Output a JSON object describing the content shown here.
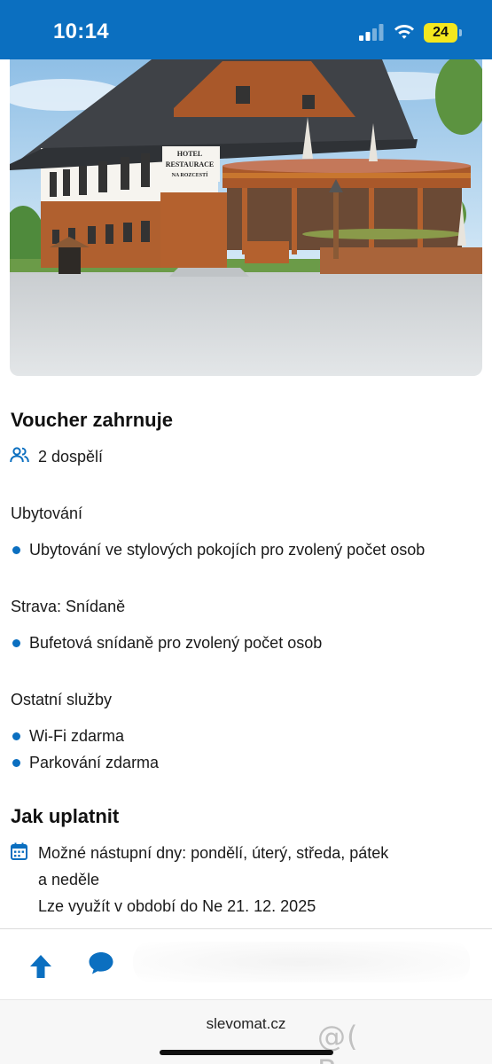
{
  "status_bar": {
    "time": "10:14",
    "battery_level": "24",
    "battery_color": "#f4e71e",
    "background_color": "#0b6fc0",
    "icons": [
      "signal-icon",
      "wifi-icon",
      "battery-icon"
    ]
  },
  "hero": {
    "sign_lines": [
      "HOTEL",
      "RESTAURACE",
      "NA ROZCESTÍ"
    ]
  },
  "voucher": {
    "title": "Voucher zahrnuje",
    "guests": "2 dospělí",
    "guests_icon": "people-icon"
  },
  "accommodation": {
    "heading": "Ubytování",
    "items": [
      "Ubytování ve stylových pokojích pro zvolený počet osob"
    ]
  },
  "meals": {
    "heading": "Strava: Snídaně",
    "items": [
      "Bufetová snídaně pro zvolený počet osob"
    ]
  },
  "other_services": {
    "heading": "Ostatní služby",
    "items": [
      "Wi-Fi zdarma",
      "Parkování zdarma"
    ]
  },
  "redeem": {
    "title": "Jak uplatnit",
    "calendar_icon": "calendar-icon",
    "lines": [
      "Možné nástupní dny: pondělí, úterý, středa, pátek",
      "a neděle",
      "Lze využít v období do Ne 21. 12. 2025"
    ]
  },
  "toolbar": {
    "icons": [
      "arrow-up-icon",
      "chat-bubble-icon"
    ],
    "accent_color": "#0b6fc0"
  },
  "browser": {
    "url": "slevomat.cz",
    "watermark": "@( Bazos.cz"
  }
}
